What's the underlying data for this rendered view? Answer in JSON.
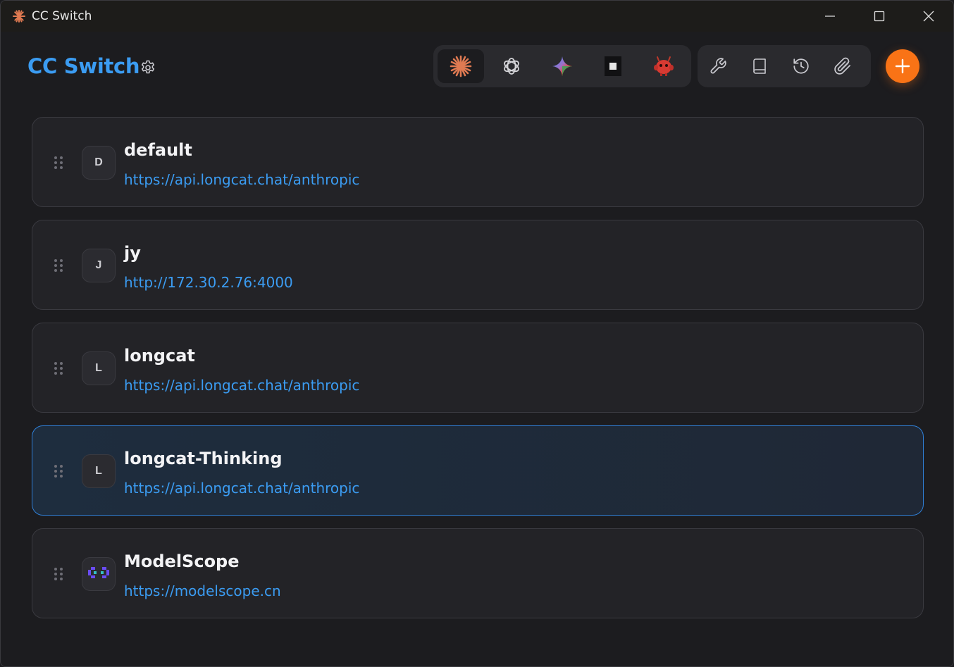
{
  "window": {
    "title": "CC Switch"
  },
  "header": {
    "brand": "CC Switch"
  },
  "icons": {
    "app_icon": "claude-burst-icon",
    "settings": "gear-icon",
    "apps": [
      "claude-icon",
      "openai-icon",
      "gemini-icon",
      "terminal-square-icon",
      "red-mascot-icon"
    ],
    "tools": [
      "wrench-icon",
      "book-icon",
      "history-icon",
      "paperclip-icon"
    ],
    "add": "plus-icon"
  },
  "colors": {
    "accent": "#3b9cf2",
    "add_button": "#f97316",
    "active_border": "#2f7fd6"
  },
  "providers": [
    {
      "initial": "D",
      "name": "default",
      "url": "https://api.longcat.chat/anthropic",
      "active": false
    },
    {
      "initial": "J",
      "name": "jy",
      "url": "http://172.30.2.76:4000",
      "active": false
    },
    {
      "initial": "L",
      "name": "longcat",
      "url": "https://api.longcat.chat/anthropic",
      "active": false
    },
    {
      "initial": "L",
      "name": "longcat-Thinking",
      "url": "https://api.longcat.chat/anthropic",
      "active": true
    },
    {
      "initial": "",
      "name": "ModelScope",
      "url": "https://modelscope.cn",
      "active": false
    }
  ]
}
